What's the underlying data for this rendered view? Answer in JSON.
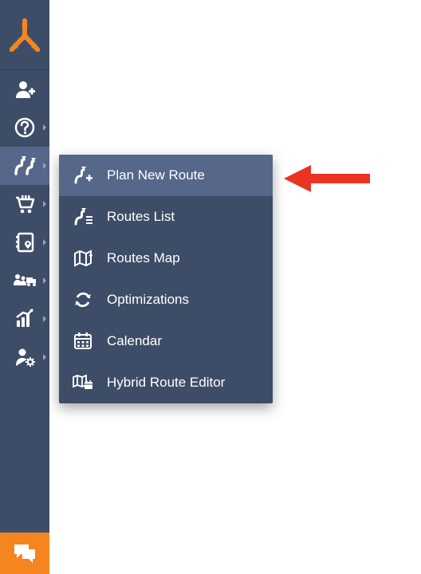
{
  "colors": {
    "sidebar_bg": "#3e4d67",
    "active_bg": "#56678a",
    "accent": "#f5851f",
    "arrow": "#ea3323",
    "icon": "#ffffff"
  },
  "flyout": {
    "items": [
      {
        "label": "Plan New Route",
        "icon": "route-plus-icon",
        "selected": true
      },
      {
        "label": "Routes List",
        "icon": "route-list-icon",
        "selected": false
      },
      {
        "label": "Routes Map",
        "icon": "map-icon",
        "selected": false
      },
      {
        "label": "Optimizations",
        "icon": "refresh-icon",
        "selected": false
      },
      {
        "label": "Calendar",
        "icon": "calendar-icon",
        "selected": false
      },
      {
        "label": "Hybrid Route Editor",
        "icon": "hybrid-editor-icon",
        "selected": false
      }
    ]
  },
  "sidebar": {
    "items": [
      {
        "name": "add-user",
        "has_caret": false,
        "active": false
      },
      {
        "name": "help",
        "has_caret": true,
        "active": false
      },
      {
        "name": "routes",
        "has_caret": true,
        "active": true
      },
      {
        "name": "orders",
        "has_caret": true,
        "active": false
      },
      {
        "name": "address-book",
        "has_caret": true,
        "active": false
      },
      {
        "name": "team",
        "has_caret": true,
        "active": false
      },
      {
        "name": "analytics",
        "has_caret": true,
        "active": false
      },
      {
        "name": "user-settings",
        "has_caret": true,
        "active": false
      }
    ]
  }
}
